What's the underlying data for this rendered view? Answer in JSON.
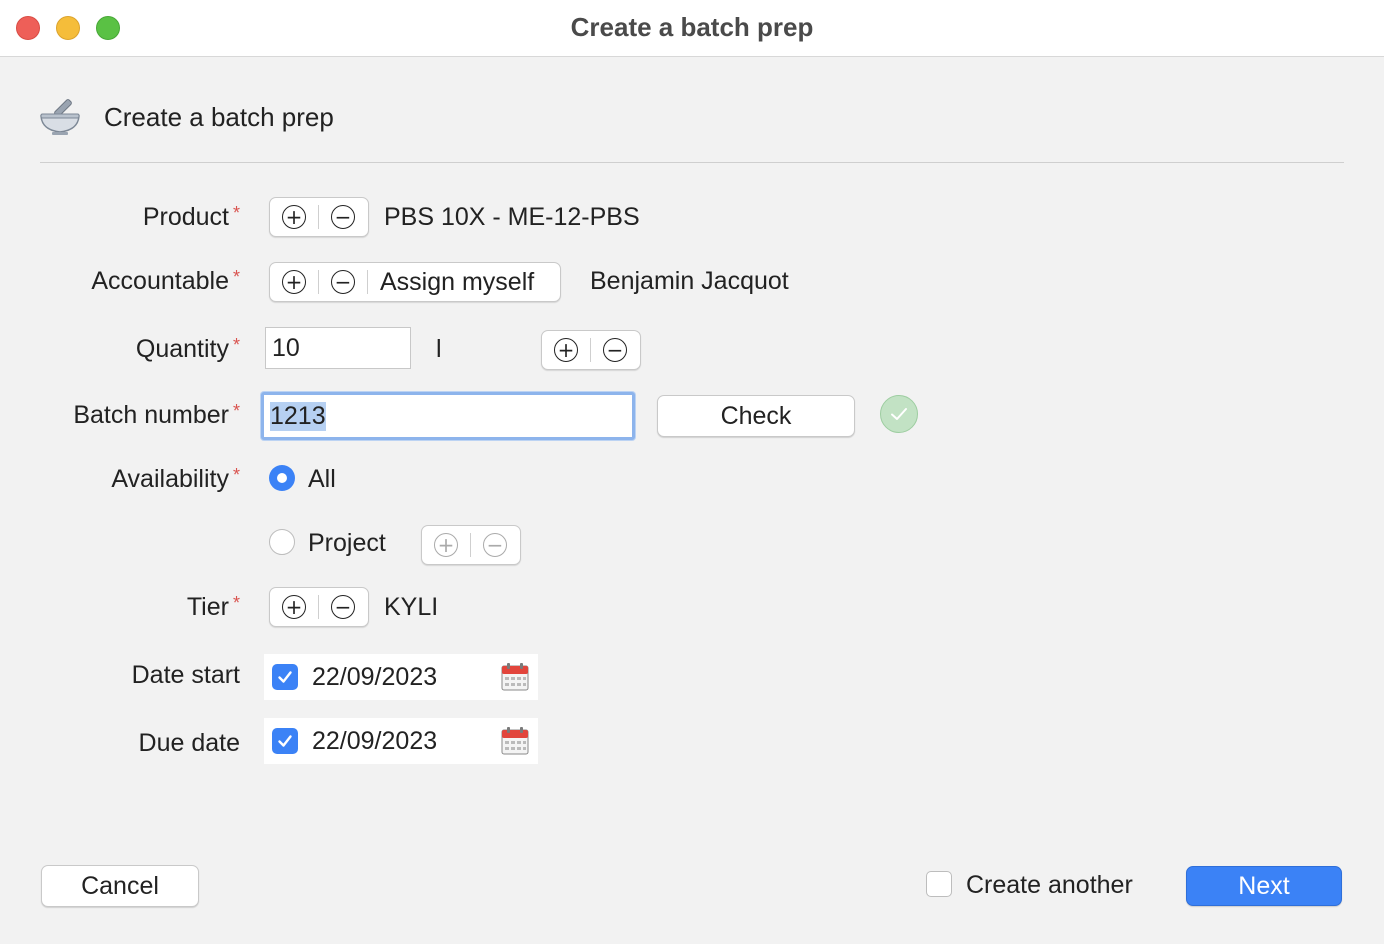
{
  "window": {
    "title": "Create a batch prep"
  },
  "header": {
    "title": "Create a batch prep",
    "icon": "mortar-pestle-icon"
  },
  "form": {
    "product": {
      "label": "Product",
      "value": "PBS 10X - ME-12-PBS"
    },
    "accountable": {
      "label": "Accountable",
      "assign_label": "Assign myself",
      "value": "Benjamin Jacquot"
    },
    "quantity": {
      "label": "Quantity",
      "value": "10",
      "unit": "l"
    },
    "batch_number": {
      "label": "Batch number",
      "value": "1213",
      "check_label": "Check",
      "status_icon": "checkmark-icon"
    },
    "availability": {
      "label": "Availability",
      "options": [
        {
          "label": "All",
          "selected": true
        },
        {
          "label": "Project",
          "selected": false
        }
      ]
    },
    "tier": {
      "label": "Tier",
      "value": "KYLI"
    },
    "date_start": {
      "label": "Date start",
      "value": "22/09/2023",
      "checked": true
    },
    "due_date": {
      "label": "Due date",
      "value": "22/09/2023",
      "checked": true
    },
    "required_marker": "*"
  },
  "footer": {
    "cancel_label": "Cancel",
    "create_another_label": "Create another",
    "create_another_checked": false,
    "next_label": "Next"
  },
  "icons": {
    "plus": "+",
    "minus": "−",
    "check": "✓"
  },
  "colors": {
    "accent": "#3b82f6",
    "required": "#d9534f",
    "success": "#c2e2c4"
  }
}
